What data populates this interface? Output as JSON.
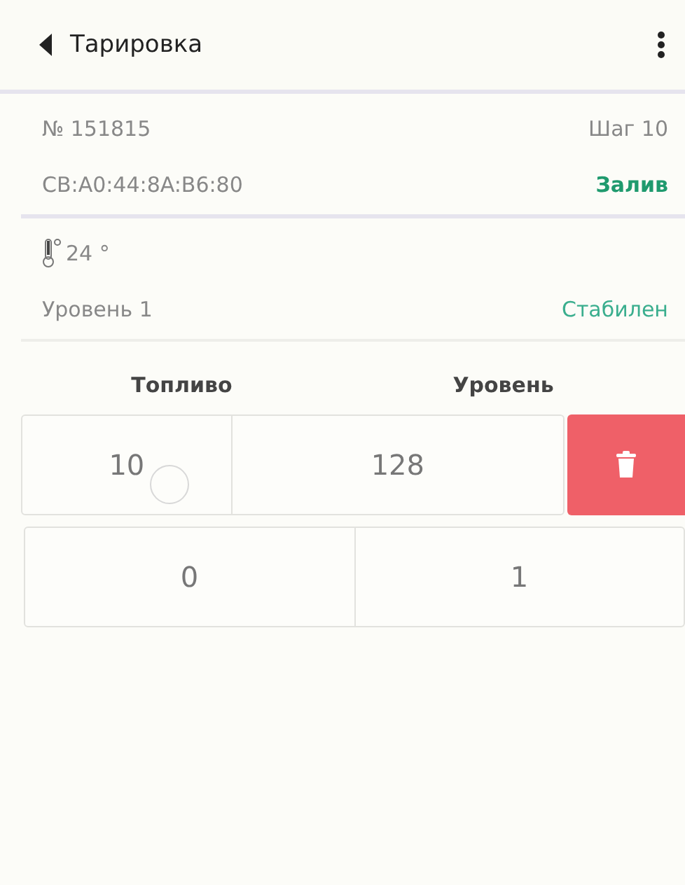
{
  "header": {
    "title": "Тарировка"
  },
  "device": {
    "number": "№ 151815",
    "step": "Шаг 10",
    "mac": "CB:A0:44:8A:B6:80",
    "mode": "Залив"
  },
  "sensor": {
    "temperature": "24 °",
    "level_name": "Уровень 1",
    "status": "Стабилен"
  },
  "table": {
    "columns": [
      "Топливо",
      "Уровень"
    ],
    "rows": [
      {
        "fuel": "10",
        "level": "128",
        "delete_revealed": true
      },
      {
        "fuel": "0",
        "level": "1",
        "delete_revealed": false
      }
    ]
  }
}
